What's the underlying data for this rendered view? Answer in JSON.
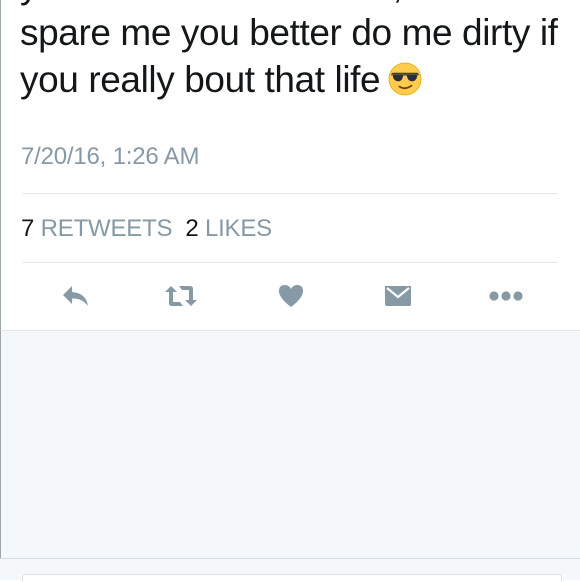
{
  "tweet": {
    "text_lines": [
      "you catch me downbad, don't",
      "spare me you better do me dirty if",
      "you really bout that life"
    ],
    "emoji": "sunglasses-face",
    "timestamp": "7/20/16, 1:26 AM"
  },
  "stats": {
    "retweets_count": "7",
    "retweets_label": "RETWEETS",
    "likes_count": "2",
    "likes_label": "LIKES"
  },
  "actions": [
    {
      "icon": "reply-icon"
    },
    {
      "icon": "retweet-icon"
    },
    {
      "icon": "heart-icon"
    },
    {
      "icon": "direct-message-icon"
    },
    {
      "icon": "more-icon"
    }
  ],
  "colors": {
    "text": "#14171a",
    "muted": "#8899a6",
    "icon": "#8899a6",
    "divider": "#e1e8ed",
    "background_below": "#f5f8fa"
  }
}
